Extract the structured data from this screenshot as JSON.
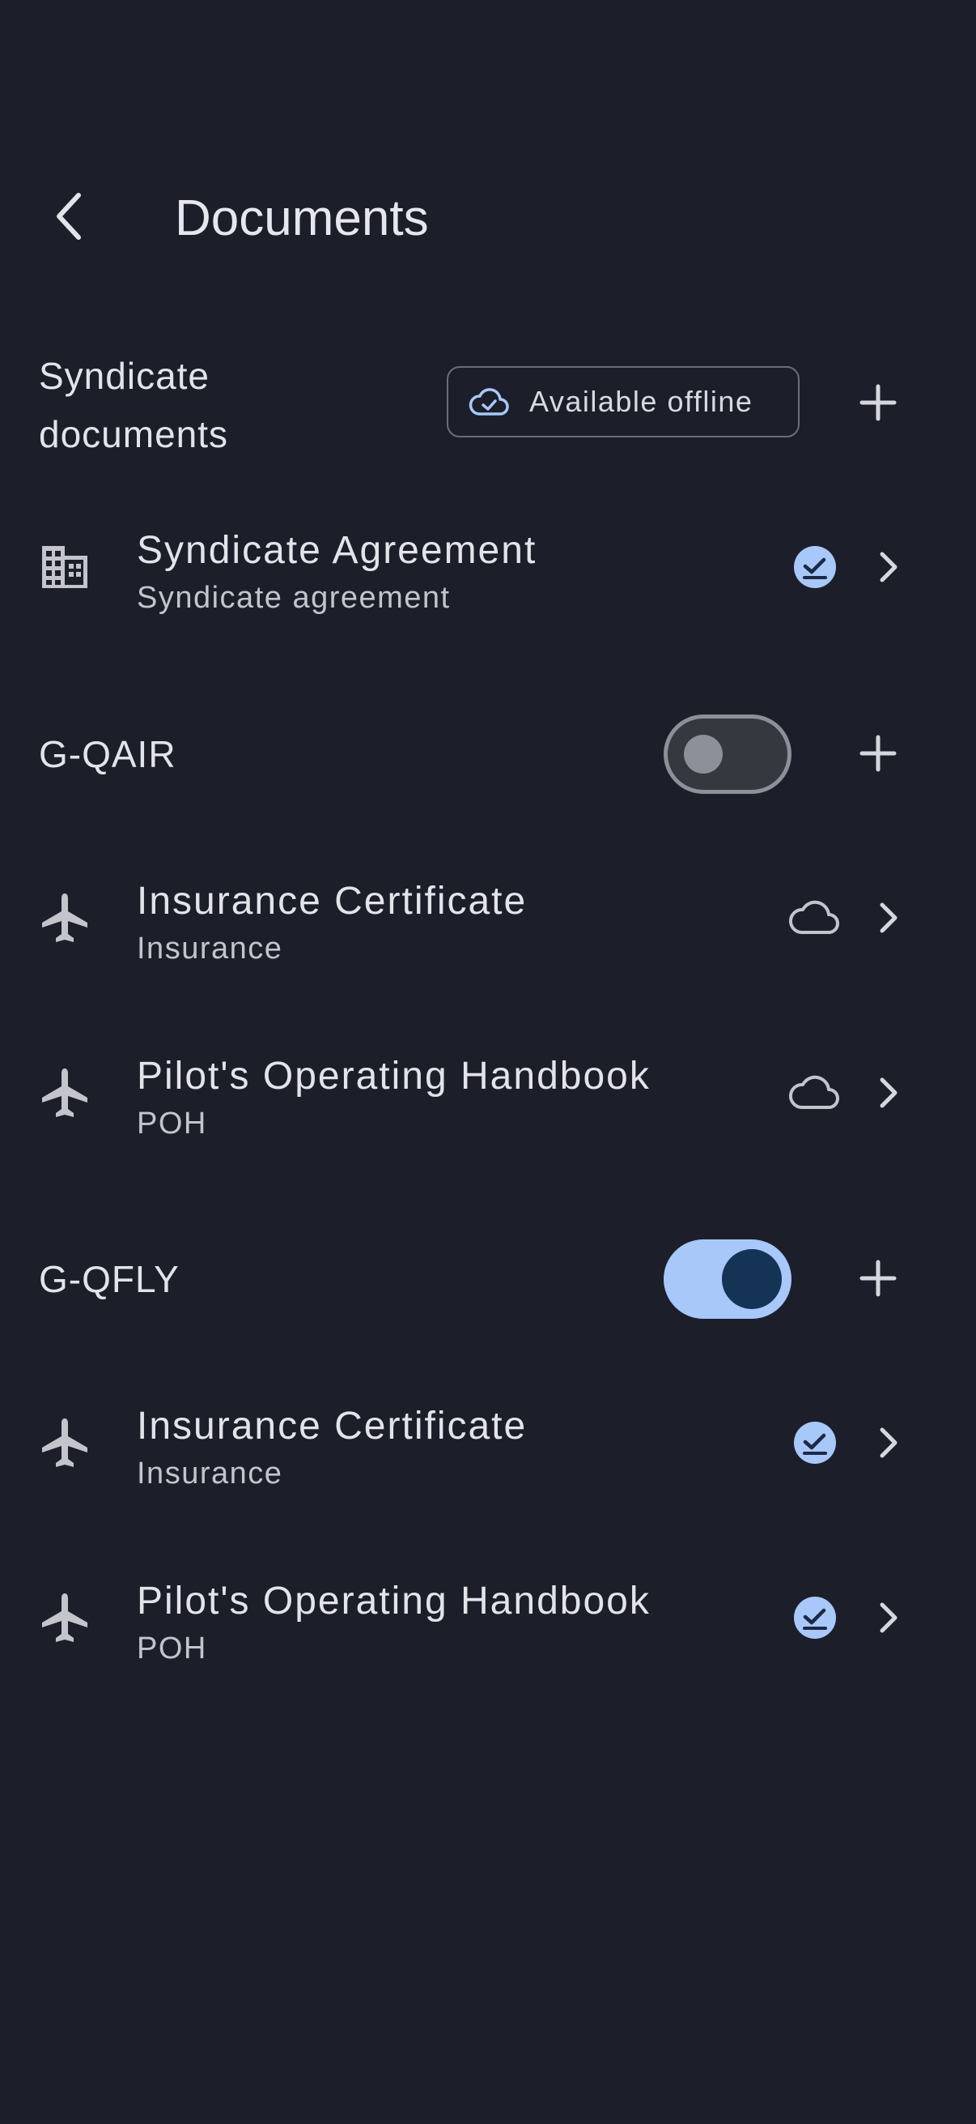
{
  "header": {
    "title": "Documents",
    "back_icon": "chevron-left-icon"
  },
  "colors": {
    "background": "#1c1f2a",
    "accent": "#a8c8fa",
    "accent_dark": "#153355",
    "text": "#e3e3ea",
    "muted": "#c3c4cc"
  },
  "sections": [
    {
      "title_line1": "Syndicate",
      "title_line2": "documents",
      "offline_chip": {
        "label": "Available offline",
        "icon": "cloud-check-icon"
      },
      "items": [
        {
          "title": "Syndicate Agreement",
          "subtitle": "Syndicate agreement",
          "icon": "building-icon",
          "status": "downloaded"
        }
      ]
    },
    {
      "title": "G-QAIR",
      "offline_enabled": false,
      "items": [
        {
          "title": "Insurance Certificate",
          "subtitle": "Insurance",
          "icon": "airplane-icon",
          "status": "cloud"
        },
        {
          "title": "Pilot's Operating Handbook",
          "subtitle": "POH",
          "icon": "airplane-icon",
          "status": "cloud"
        }
      ]
    },
    {
      "title": "G-QFLY",
      "offline_enabled": true,
      "items": [
        {
          "title": "Insurance Certificate",
          "subtitle": "Insurance",
          "icon": "airplane-icon",
          "status": "downloaded"
        },
        {
          "title": "Pilot's Operating Handbook",
          "subtitle": "POH",
          "icon": "airplane-icon",
          "status": "downloaded"
        }
      ]
    }
  ]
}
